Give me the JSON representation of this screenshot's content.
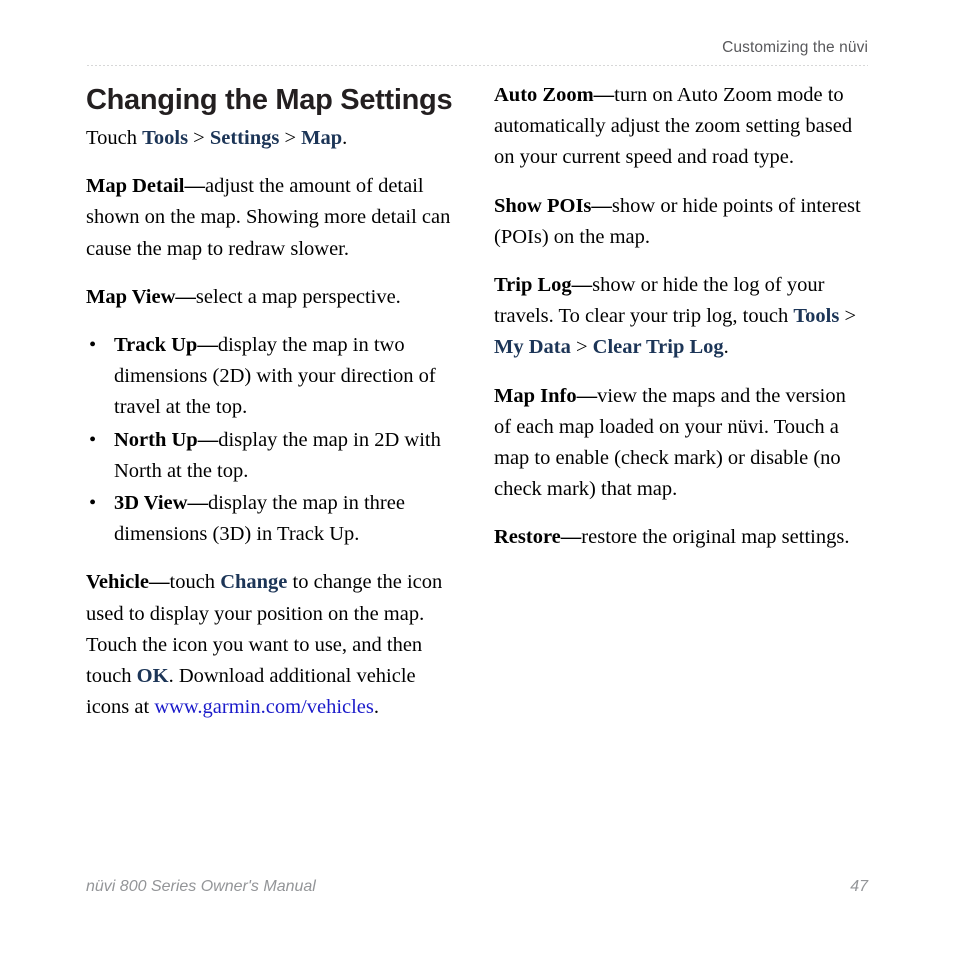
{
  "header": {
    "running_title": "Customizing the nüvi"
  },
  "left_column": {
    "section_title": "Changing the Map Settings",
    "intro": {
      "lead": "Touch ",
      "path": [
        "Tools",
        "Settings",
        "Map"
      ],
      "separator": " > ",
      "trailing": "."
    },
    "entries": [
      {
        "term": "Map Detail",
        "dash": "—",
        "text": "adjust the amount of detail shown on the map. Showing more detail can cause the map to redraw slower."
      },
      {
        "term": "Map View",
        "dash": "—",
        "text": "select a map perspective."
      }
    ],
    "bullets": [
      {
        "marker": "•",
        "term": "Track Up",
        "dash": "—",
        "text": "display the map in two dimensions (2D) with your direction of travel at the top."
      },
      {
        "marker": "•",
        "term": "North Up",
        "dash": "—",
        "text": "display the map in 2D with North at the top."
      },
      {
        "marker": "•",
        "term": "3D View",
        "dash": "—",
        "text": "display the map in three dimensions (3D) in Track Up."
      }
    ],
    "vehicle": {
      "term": "Vehicle",
      "dash": "—",
      "text_1": "touch ",
      "ui_1": "Change",
      "text_2": " to change the icon used to display your position on the map. Touch the icon you want to use, and then touch ",
      "ui_2": "OK",
      "text_3": ". Download additional vehicle icons at ",
      "link": "www.garmin.com/vehicles",
      "text_4": "."
    }
  },
  "right_column": {
    "entries": [
      {
        "term": "Auto Zoom",
        "dash": "—",
        "text": "turn on Auto Zoom mode to automatically adjust the zoom setting based on your current speed and road type."
      },
      {
        "term": "Show POIs",
        "dash": "—",
        "text": "show or hide points of interest (POIs) on the map."
      }
    ],
    "trip_log": {
      "term": "Trip Log",
      "dash": "—",
      "text_1": "show or hide the log of your travels. To clear your trip log, touch ",
      "path": [
        "Tools",
        "My Data",
        "Clear Trip Log"
      ],
      "separator": " > ",
      "trailing": "."
    },
    "entries_2": [
      {
        "term": "Map Info",
        "dash": "—",
        "text": "view the maps and the version of each map loaded on your nüvi. Touch a map to enable (check mark) or disable (no check mark) that map."
      },
      {
        "term": "Restore",
        "dash": "—",
        "text": "restore the original map settings."
      }
    ]
  },
  "footer": {
    "manual_name": "nüvi 800 Series Owner's Manual",
    "page_number": "47"
  },
  "colors": {
    "ui_term": "#1c3557",
    "link": "#1a1aca",
    "header_text": "#58585b",
    "footer_text": "#939598",
    "title_text": "#231f20",
    "body_text": "#000000"
  }
}
